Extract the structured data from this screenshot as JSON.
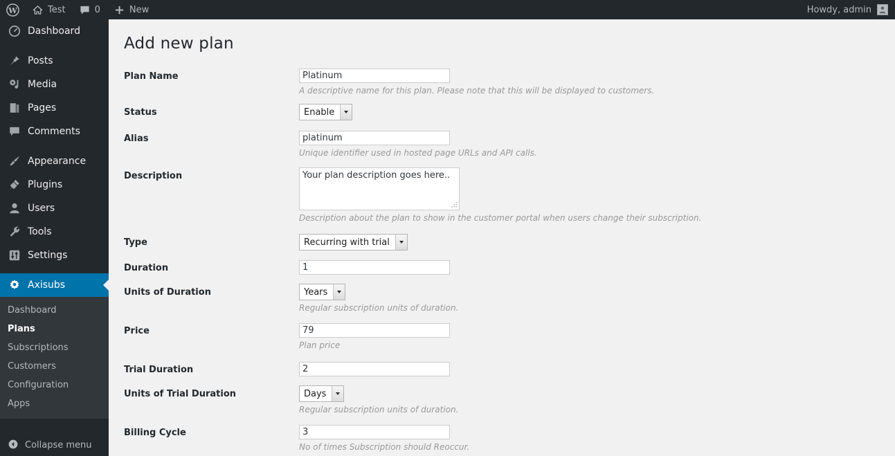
{
  "adminbar": {
    "logo_icon": "wordpress-logo-icon",
    "site_name": "Test",
    "site_icon": "home-icon",
    "comments_icon": "comment-bubble-icon",
    "comments_count": "0",
    "new_icon": "plus-icon",
    "new_label": "New",
    "howdy": "Howdy, admin",
    "avatar_icon": "avatar-icon"
  },
  "sidebar": {
    "items": [
      {
        "label": "Dashboard",
        "icon": "dashboard-icon",
        "current": false
      },
      {
        "label": "Posts",
        "icon": "pin-icon",
        "current": false
      },
      {
        "label": "Media",
        "icon": "media-icon",
        "current": false
      },
      {
        "label": "Pages",
        "icon": "pages-icon",
        "current": false
      },
      {
        "label": "Comments",
        "icon": "comment-bubble-icon",
        "current": false
      },
      {
        "label": "Appearance",
        "icon": "paintbrush-icon",
        "current": false
      },
      {
        "label": "Plugins",
        "icon": "plug-icon",
        "current": false
      },
      {
        "label": "Users",
        "icon": "user-icon",
        "current": false
      },
      {
        "label": "Tools",
        "icon": "wrench-icon",
        "current": false
      },
      {
        "label": "Settings",
        "icon": "sliders-icon",
        "current": false
      },
      {
        "label": "Axisubs",
        "icon": "gear-icon",
        "current": true
      }
    ],
    "submenu": [
      {
        "label": "Dashboard",
        "current": false
      },
      {
        "label": "Plans",
        "current": true
      },
      {
        "label": "Subscriptions",
        "current": false
      },
      {
        "label": "Customers",
        "current": false
      },
      {
        "label": "Configuration",
        "current": false
      },
      {
        "label": "Apps",
        "current": false
      }
    ],
    "collapse_label": "Collapse menu",
    "collapse_icon": "arrow-left-circle-icon",
    "active_color": "#0073aa",
    "background_color": "#23282d",
    "submenu_background_color": "#32373c"
  },
  "page": {
    "title": "Add new plan",
    "fields": [
      {
        "label": "Plan Name",
        "control": "text",
        "value": "Platinum",
        "hint": "A descriptive name for this plan. Please note that this will be displayed to customers."
      },
      {
        "label": "Status",
        "control": "select",
        "value": "Enable",
        "hint": ""
      },
      {
        "label": "Alias",
        "control": "text",
        "value": "platinum",
        "hint": "Unique identifier used in hosted page URLs and API calls."
      },
      {
        "label": "Description",
        "control": "textarea",
        "value": "Your plan description goes here..",
        "hint": "Description about the plan to show in the customer portal when users change their subscription."
      },
      {
        "label": "Type",
        "control": "select",
        "value": "Recurring with trial",
        "hint": ""
      },
      {
        "label": "Duration",
        "control": "text",
        "value": "1",
        "hint": ""
      },
      {
        "label": "Units of Duration",
        "control": "select",
        "value": "Years",
        "hint": "Regular subscription units of duration."
      },
      {
        "label": "Price",
        "control": "text",
        "value": "79",
        "hint": "Plan price"
      },
      {
        "label": "Trial Duration",
        "control": "text",
        "value": "2",
        "hint": ""
      },
      {
        "label": "Units of Trial Duration",
        "control": "select",
        "value": "Days",
        "hint": "Regular subscription units of duration."
      },
      {
        "label": "Billing Cycle",
        "control": "text",
        "value": "3",
        "hint": "No of times Subscription should Reoccur."
      }
    ]
  }
}
